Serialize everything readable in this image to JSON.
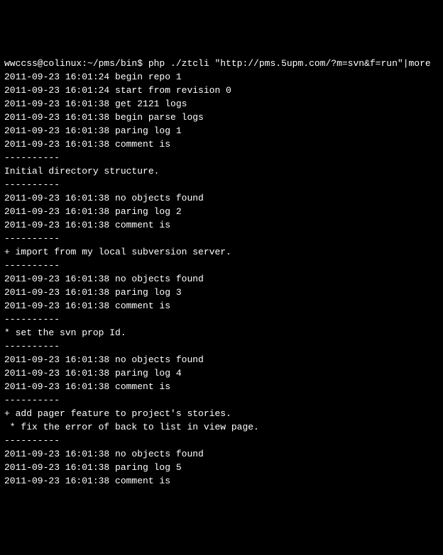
{
  "terminal": {
    "prompt": "wwccss@colinux:~/pms/bin$ php ./ztcli \"http://pms.5upm.com/?m=svn&f=run\"|more",
    "lines": [
      "2011-09-23 16:01:24 begin repo 1",
      "2011-09-23 16:01:24 start from revision 0",
      "2011-09-23 16:01:38 get 2121 logs",
      "2011-09-23 16:01:38 begin parse logs",
      "2011-09-23 16:01:38 paring log 1",
      "2011-09-23 16:01:38 comment is",
      "----------",
      "Initial directory structure.",
      "----------",
      "2011-09-23 16:01:38 no objects found",
      "",
      "2011-09-23 16:01:38 paring log 2",
      "2011-09-23 16:01:38 comment is",
      "----------",
      "+ import from my local subversion server.",
      "----------",
      "2011-09-23 16:01:38 no objects found",
      "",
      "2011-09-23 16:01:38 paring log 3",
      "2011-09-23 16:01:38 comment is",
      "----------",
      "* set the svn prop Id.",
      "----------",
      "2011-09-23 16:01:38 no objects found",
      "",
      "2011-09-23 16:01:38 paring log 4",
      "2011-09-23 16:01:38 comment is",
      "----------",
      "+ add pager feature to project's stories.",
      " * fix the error of back to list in view page.",
      "----------",
      "2011-09-23 16:01:38 no objects found",
      "",
      "2011-09-23 16:01:38 paring log 5",
      "2011-09-23 16:01:38 comment is"
    ]
  }
}
